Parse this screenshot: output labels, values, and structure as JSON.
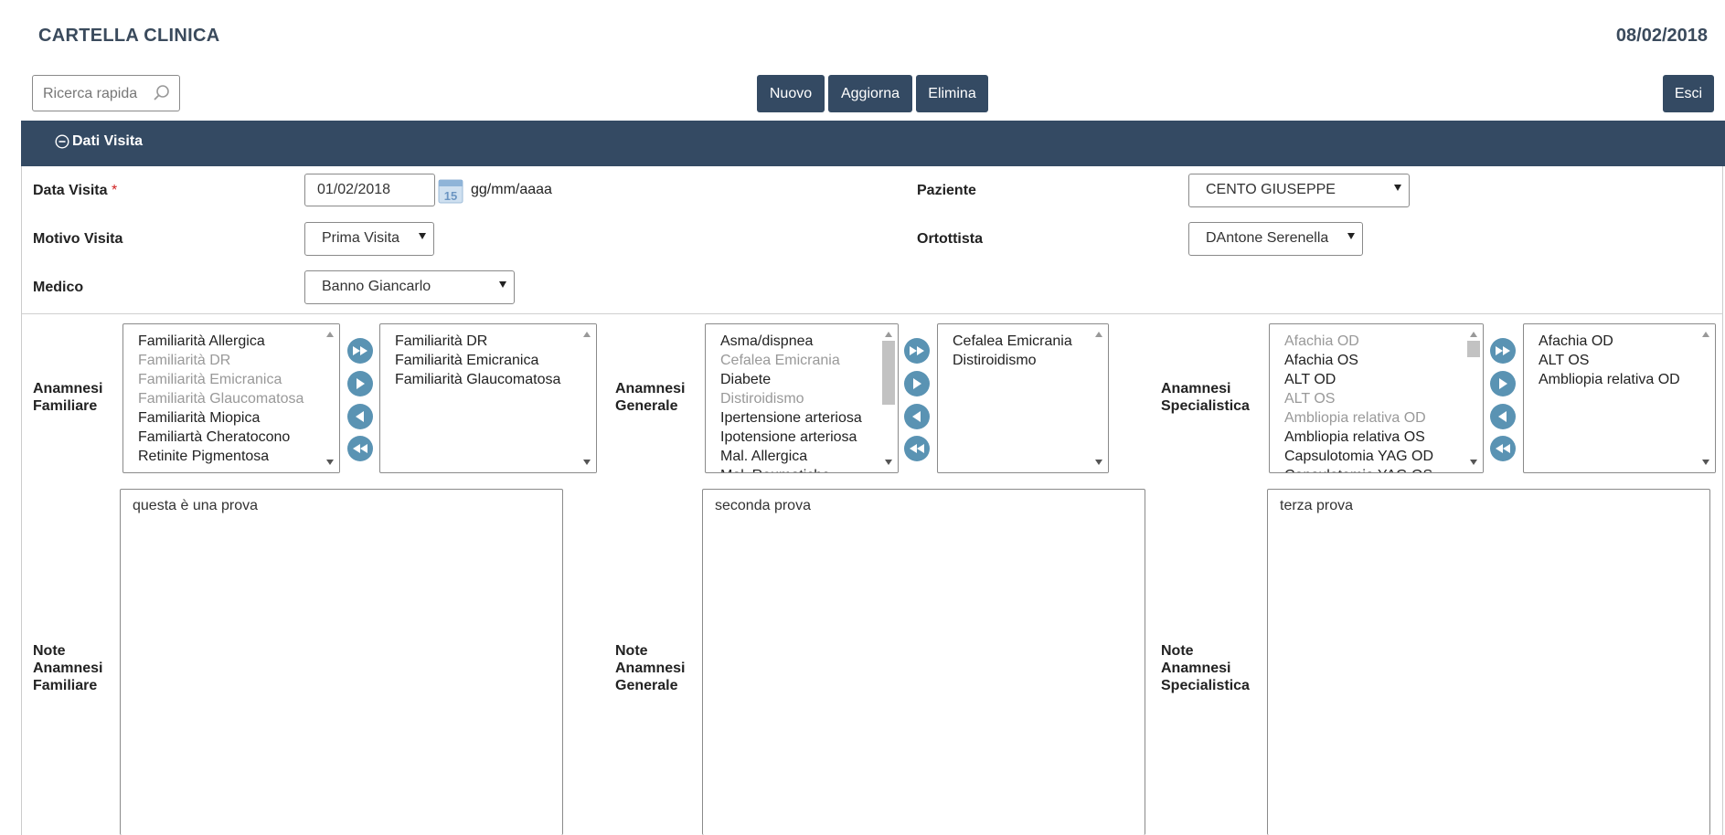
{
  "header": {
    "title": "CARTELLA CLINICA",
    "date": "08/02/2018"
  },
  "search": {
    "placeholder": "Ricerca rapida"
  },
  "toolbar": {
    "new_label": "Nuovo",
    "update_label": "Aggiorna",
    "delete_label": "Elimina",
    "exit_label": "Esci"
  },
  "section": {
    "title": "Dati Visita"
  },
  "form": {
    "data_visita_label": "Data Visita",
    "data_visita_required": "*",
    "data_visita_value": "01/02/2018",
    "date_format_hint": "gg/mm/aaaa",
    "calendar_icon_text": "15",
    "motivo_label": "Motivo Visita",
    "motivo_value": "Prima Visita",
    "medico_label": "Medico",
    "medico_value": "Banno Giancarlo",
    "paziente_label": "Paziente",
    "paziente_value": "CENTO GIUSEPPE",
    "ortottista_label": "Ortottista",
    "ortottista_value": "DAntone Serenella"
  },
  "anamnesi": [
    {
      "label_line1": "Anamnesi",
      "label_line2": "Familiare",
      "available": [
        {
          "text": "Familiarità Allergica",
          "dim": false
        },
        {
          "text": "Familiarità DR",
          "dim": true
        },
        {
          "text": "Familiarità Emicranica",
          "dim": true
        },
        {
          "text": "Familiarità Glaucomatosa",
          "dim": true
        },
        {
          "text": "Familiarità Miopica",
          "dim": false
        },
        {
          "text": "Familiartà Cheratocono",
          "dim": false
        },
        {
          "text": "Retinite Pigmentosa",
          "dim": false
        }
      ],
      "selected": [
        "Familiarità DR",
        "Familiarità Emicranica",
        "Familiarità Glaucomatosa"
      ],
      "note_label_1": "Note",
      "note_label_2": "Anamnesi",
      "note_label_3": "Familiare",
      "note_value": "questa è una prova"
    },
    {
      "label_line1": "Anamnesi",
      "label_line2": "Generale",
      "available": [
        {
          "text": "Asma/dispnea",
          "dim": false
        },
        {
          "text": "Cefalea Emicrania",
          "dim": true
        },
        {
          "text": "Diabete",
          "dim": false
        },
        {
          "text": "Distiroidismo",
          "dim": true
        },
        {
          "text": "Ipertensione arteriosa",
          "dim": false
        },
        {
          "text": "Ipotensione arteriosa",
          "dim": false
        },
        {
          "text": "Mal. Allergica",
          "dim": false
        },
        {
          "text": "Mal. Reumatiche",
          "dim": false
        }
      ],
      "selected": [
        "Cefalea Emicrania",
        "Distiroidismo"
      ],
      "note_label_1": "Note",
      "note_label_2": "Anamnesi",
      "note_label_3": "Generale",
      "note_value": "seconda prova"
    },
    {
      "label_line1": "Anamnesi",
      "label_line2": "Specialistica",
      "available": [
        {
          "text": "Afachia OD",
          "dim": true
        },
        {
          "text": "Afachia OS",
          "dim": false
        },
        {
          "text": "ALT OD",
          "dim": false
        },
        {
          "text": "ALT OS",
          "dim": true
        },
        {
          "text": "Ambliopia relativa OD",
          "dim": true
        },
        {
          "text": "Ambliopia relativa OS",
          "dim": false
        },
        {
          "text": "Capsulotomia YAG OD",
          "dim": false
        },
        {
          "text": "Capsulotomia YAG OS",
          "dim": false
        }
      ],
      "selected": [
        "Afachia OD",
        "ALT OS",
        "Ambliopia relativa OD"
      ],
      "note_label_1": "Note",
      "note_label_2": "Anamnesi",
      "note_label_3": "Specialistica",
      "note_value": "terza prova"
    }
  ],
  "colors": {
    "header_bar": "#344a63",
    "button": "#344a63",
    "move_button": "#5a93b3",
    "title_text": "#3a4a5c"
  },
  "icons": {
    "search": "search-icon",
    "collapse": "minus-circle-icon",
    "calendar": "calendar-icon",
    "move_all_right": "double-right-icon",
    "move_right": "right-icon",
    "move_left": "left-icon",
    "move_all_left": "double-left-icon"
  }
}
